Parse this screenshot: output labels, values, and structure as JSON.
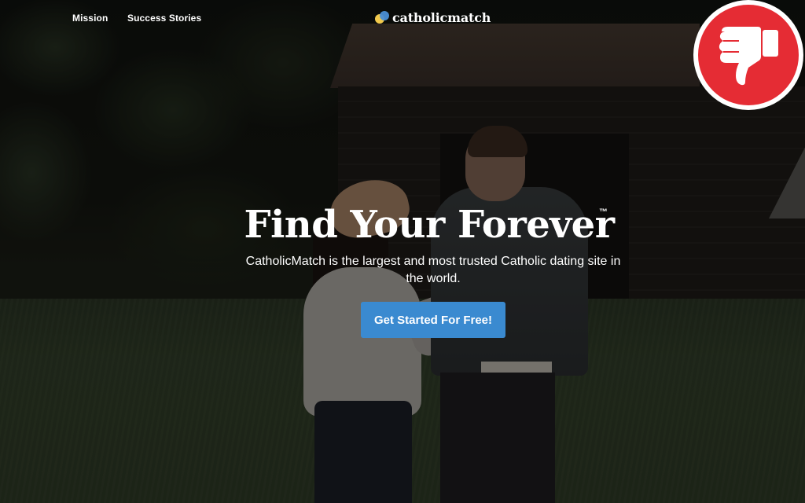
{
  "nav": {
    "links": [
      {
        "label": "Mission"
      },
      {
        "label": "Success Stories"
      }
    ]
  },
  "logo": {
    "text": "catholicmatch"
  },
  "hero": {
    "title": "Find Your Forever",
    "trademark": "™",
    "subtitle": "CatholicMatch is the largest and most trusted Catholic dating site in the world.",
    "cta_label": "Get Started For Free!"
  },
  "badge": {
    "icon": "thumbs-down-icon",
    "colors": {
      "ring": "#ffffff",
      "fill": "#e52c34"
    }
  },
  "colors": {
    "accent": "#3a8ad0",
    "logo_yellow": "#f2c94c",
    "logo_blue": "#4a8fd6"
  }
}
